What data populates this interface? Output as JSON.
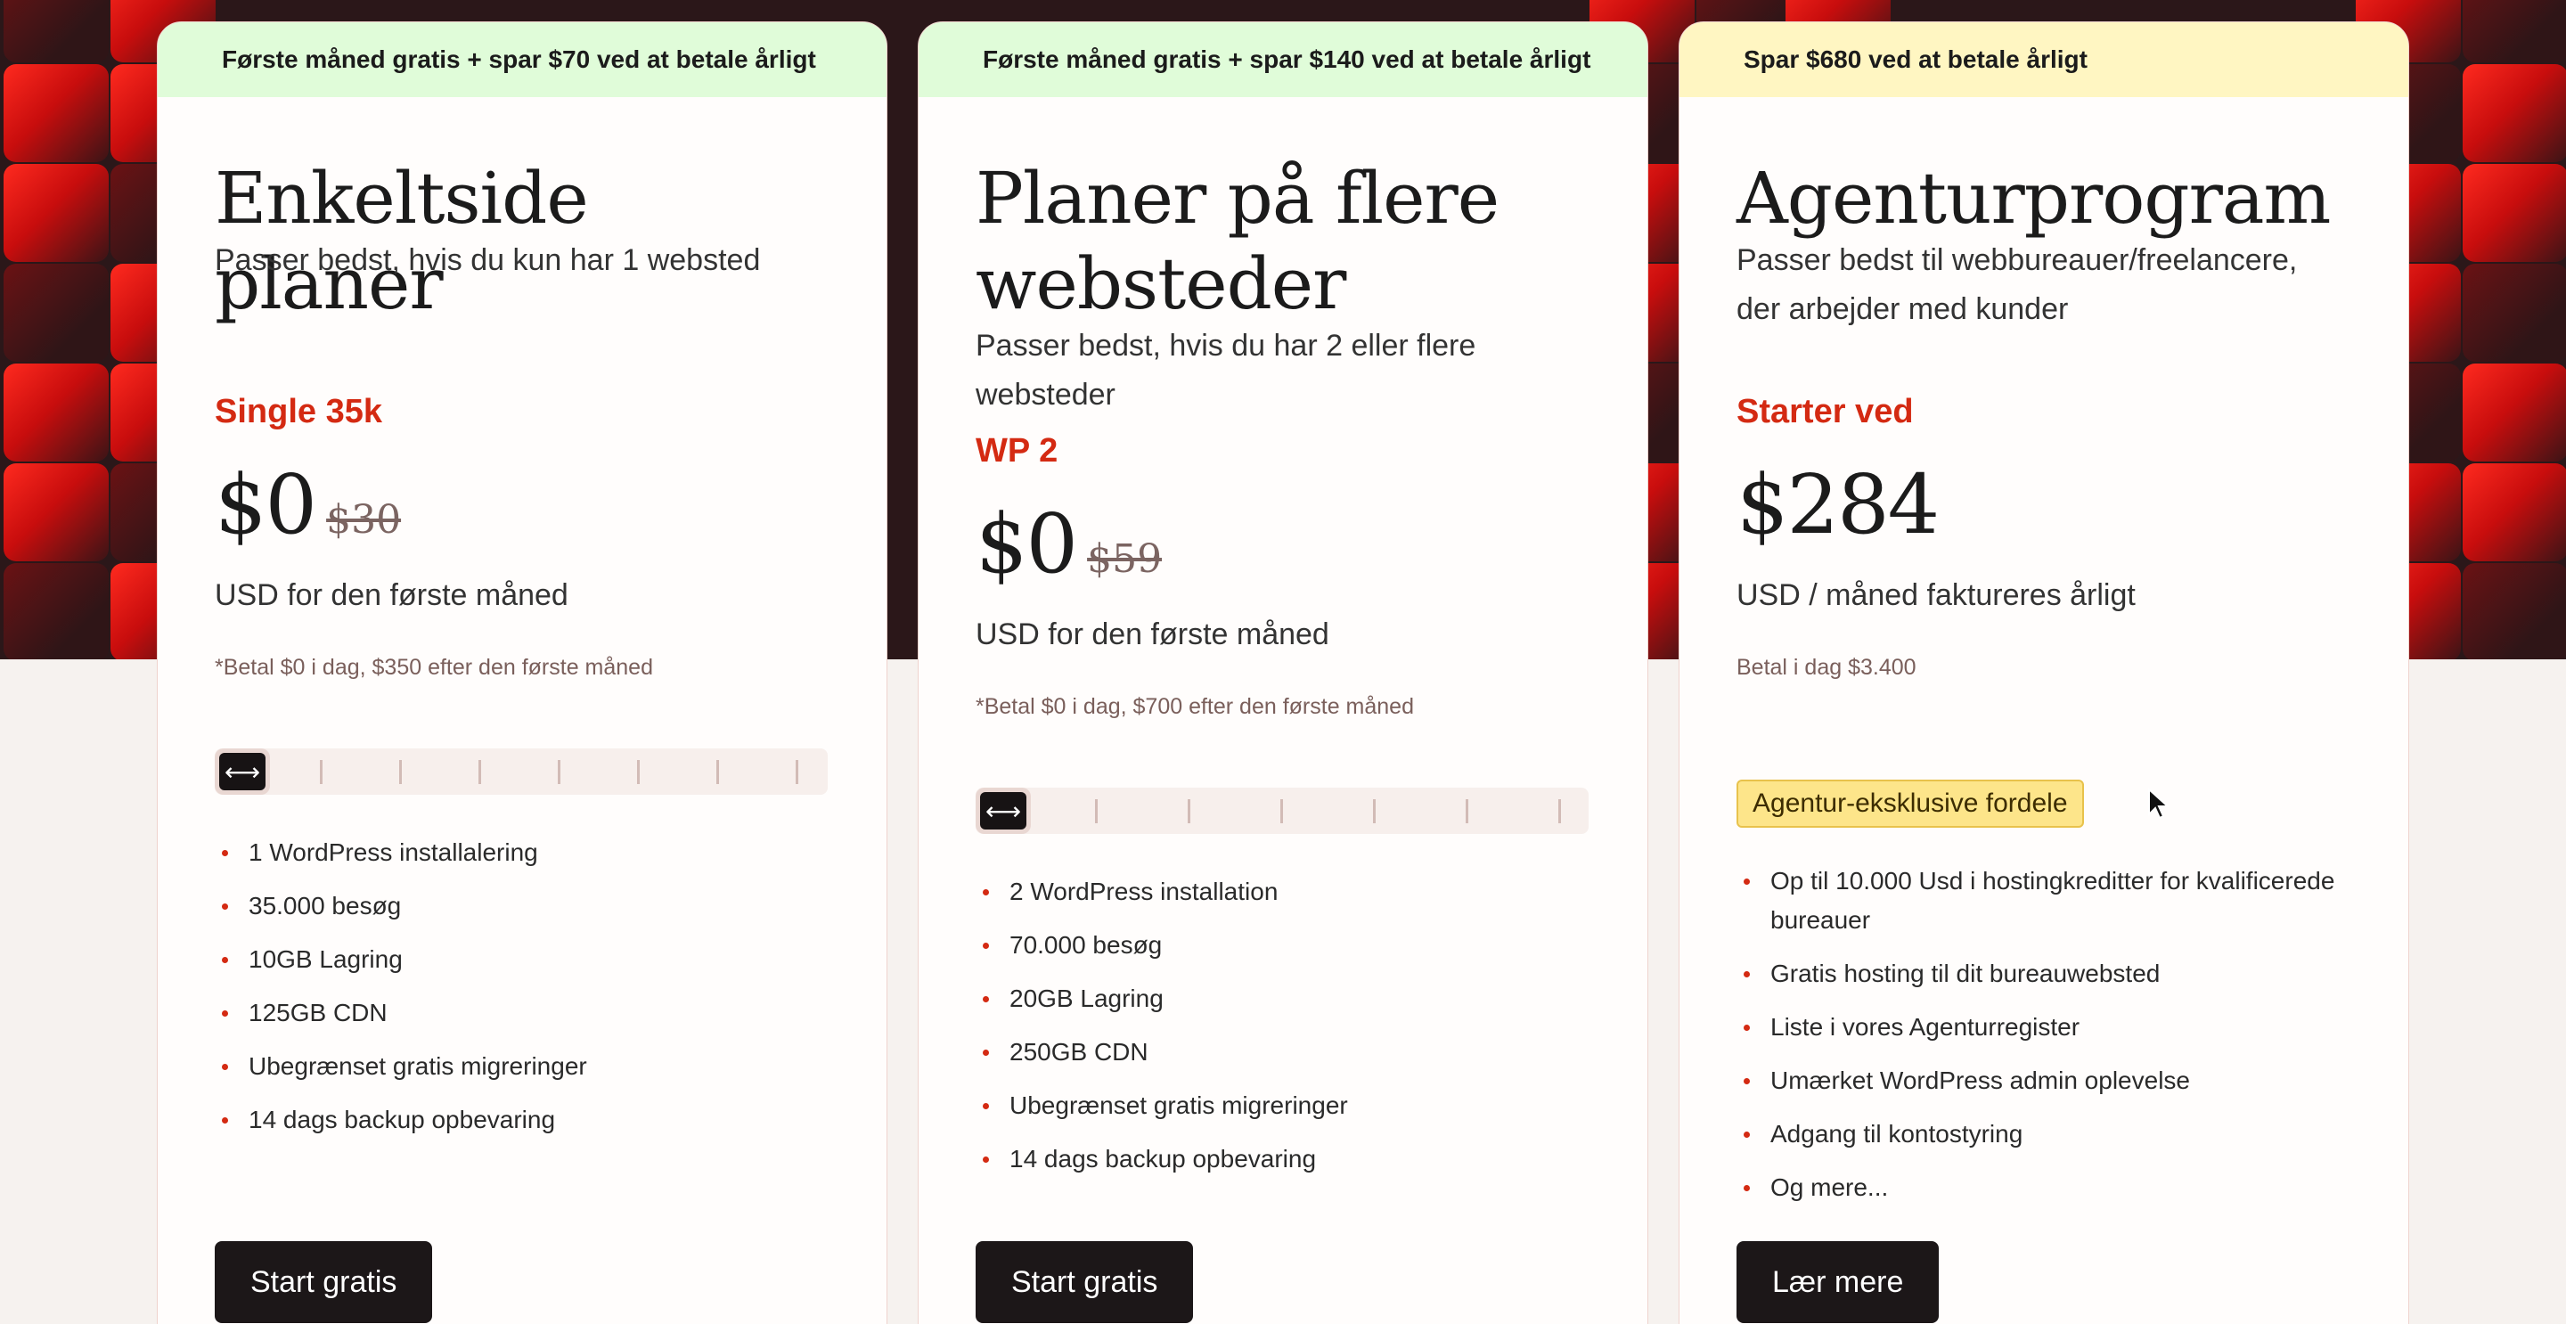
{
  "colors": {
    "accent": "#d42a12",
    "hero": "#2b1719",
    "button": "#1c1718",
    "banner_green": "#e0fcd9",
    "banner_yellow": "#fff6c2",
    "badge": "#fde58a"
  },
  "cards": [
    {
      "banner": "Første måned gratis + spar $70 ved at betale årligt",
      "title": "Enkeltside planer",
      "subtitle": "Passer bedst, hvis du kun har 1 websted",
      "plan_label": "Single 35k",
      "price": "$0",
      "old_price": "$30",
      "price_note": "USD for den første måned",
      "pay_note": "*Betal $0 i dag, $350 efter den første måned",
      "slider_icon": "horizontal-arrows-icon",
      "slider_position": 0,
      "features": [
        "1 WordPress installalering",
        "35.000 besøg",
        "10GB Lagring",
        "125GB CDN",
        "Ubegrænset gratis migreringer",
        "14 dags backup opbevaring"
      ],
      "cta": "Start gratis"
    },
    {
      "banner": "Første måned gratis + spar $140 ved at betale årligt",
      "title_line1": "Planer på flere",
      "title_line2": "websteder",
      "subtitle_line1": "Passer bedst, hvis du har 2 eller flere",
      "subtitle_line2": "websteder",
      "plan_label": "WP 2",
      "price": "$0",
      "old_price": "$59",
      "price_note": "USD for den første måned",
      "pay_note": "*Betal $0 i dag, $700 efter den første måned",
      "slider_icon": "horizontal-arrows-icon",
      "slider_position": 0,
      "features": [
        "2 WordPress installation",
        "70.000 besøg",
        "20GB Lagring",
        "250GB CDN",
        "Ubegrænset gratis migreringer",
        "14 dags backup opbevaring"
      ],
      "cta": "Start gratis"
    },
    {
      "banner": "Spar $680 ved at betale årligt",
      "title": "Agenturprogram",
      "subtitle_line1": "Passer bedst til webbureauer/freelancere,",
      "subtitle_line2": "der arbejder med kunder",
      "plan_label": "Starter ved",
      "price": "$284",
      "price_note": "USD / måned faktureres årligt",
      "pay_note": "Betal i dag $3.400",
      "badge": "Agentur-eksklusive fordele",
      "features": [
        "Op til 10.000 Usd i hostingkreditter for kvalificerede bureauer",
        "Gratis hosting til dit bureauwebsted",
        "Liste i vores Agenturregister",
        "Umærket WordPress admin oplevelse",
        "Adgang til kontostyring",
        "Og mere..."
      ],
      "cta": "Lær mere"
    }
  ]
}
